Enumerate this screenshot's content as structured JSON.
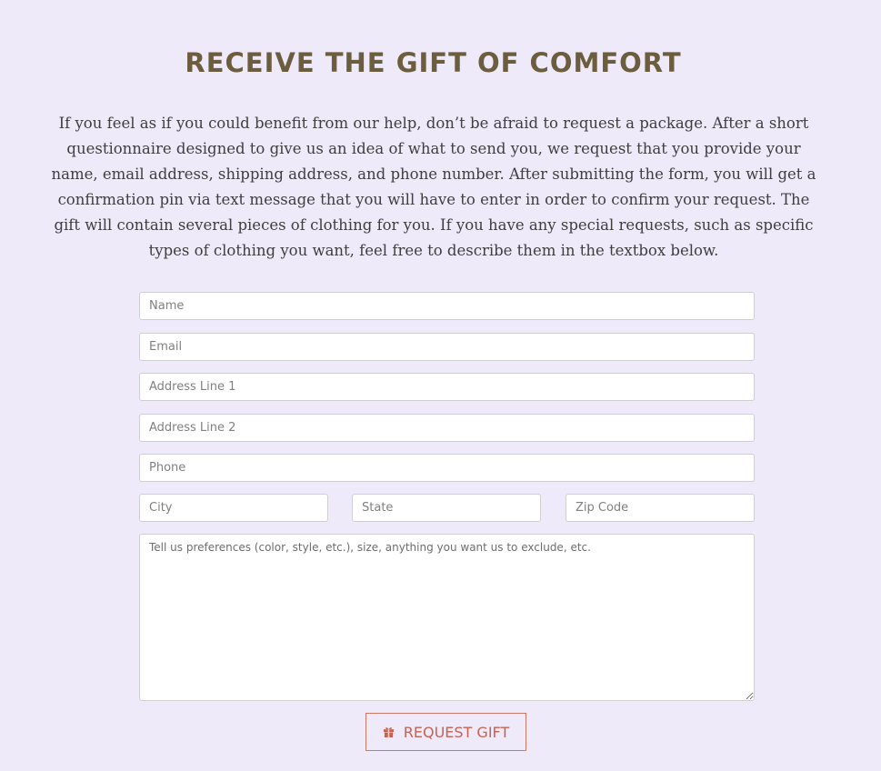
{
  "header": {
    "title": "RECEIVE THE GIFT OF COMFORT",
    "intro": "If you feel as if you could benefit from our help, don’t be afraid to request a package. After a short questionnaire designed to give us an idea of what to send you, we request that you provide your name, email address, shipping address, and phone number. After submitting the form, you will get a confirmation pin via text message that you will have to enter in order to confirm your request. The gift will contain several pieces of clothing for you. If you have any special requests, such as specific types of clothing you want, feel free to describe them in the textbox below."
  },
  "form": {
    "name": {
      "placeholder": "Name",
      "value": ""
    },
    "email": {
      "placeholder": "Email",
      "value": ""
    },
    "address1": {
      "placeholder": "Address Line 1",
      "value": ""
    },
    "address2": {
      "placeholder": "Address Line 2",
      "value": ""
    },
    "phone": {
      "placeholder": "Phone",
      "value": ""
    },
    "city": {
      "placeholder": "City",
      "value": ""
    },
    "state": {
      "placeholder": "State",
      "value": ""
    },
    "zip": {
      "placeholder": "Zip Code",
      "value": ""
    },
    "preferences": {
      "placeholder": "Tell us preferences (color, style, etc.), size, anything you want us to exclude, etc.",
      "value": ""
    },
    "submit": {
      "label": "REQUEST GIFT",
      "icon": "gift-icon"
    }
  },
  "colors": {
    "background": "#eeeafa",
    "title": "#6b5d3e",
    "accent": "#c8624f"
  }
}
